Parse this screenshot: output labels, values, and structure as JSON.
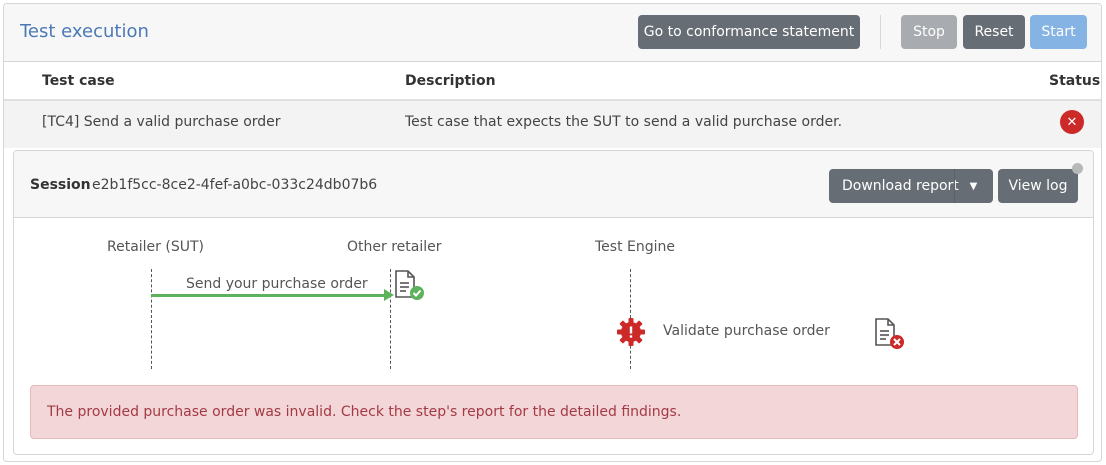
{
  "header": {
    "title": "Test execution",
    "conformance_label": "Go to conformance statement",
    "stop_label": "Stop",
    "reset_label": "Reset",
    "start_label": "Start"
  },
  "table": {
    "columns": [
      "Test case",
      "Description",
      "Status"
    ],
    "rows": [
      {
        "test_case": "[TC4] Send a valid purchase order",
        "description": "Test case that expects the SUT to send a valid purchase order.",
        "status": "error",
        "status_icon": "error-circle-icon"
      }
    ]
  },
  "session": {
    "label": "Session",
    "id": "e2b1f5cc-8ce2-4fef-a0bc-033c24db07b6",
    "download_label": "Download report",
    "view_log_label": "View log"
  },
  "diagram": {
    "actors": [
      "Retailer (SUT)",
      "Other retailer",
      "Test Engine"
    ],
    "message": {
      "label": "Send your purchase order",
      "from": "Retailer (SUT)",
      "to": "Other retailer",
      "result": "success"
    },
    "step": {
      "label": "Validate purchase order",
      "actor": "Test Engine",
      "result": "failure"
    }
  },
  "alert": {
    "text": "The provided purchase order was invalid. Check the step's report for the detailed findings."
  },
  "colors": {
    "title": "#4a7ab5",
    "button_dark": "#666d75",
    "error": "#cc2929",
    "success": "#5cb35c",
    "alert_bg": "#f2d6d8",
    "alert_text": "#a33a44"
  }
}
